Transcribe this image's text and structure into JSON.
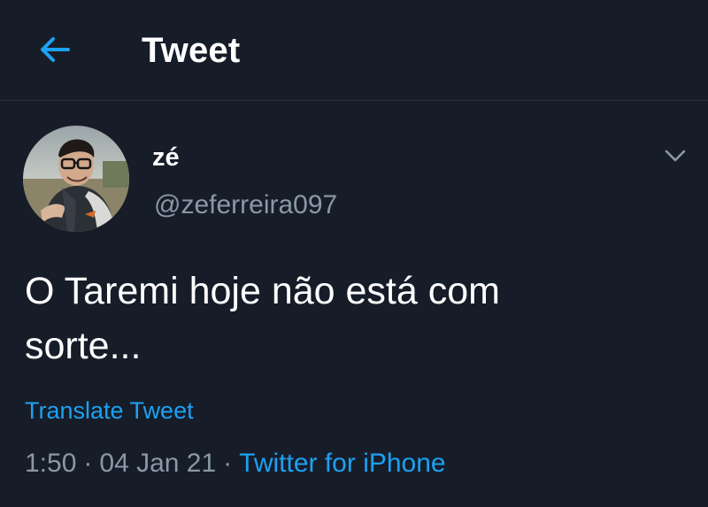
{
  "colors": {
    "background": "#161d29",
    "accent": "#1da1f2",
    "muted_text": "#8b98a6",
    "divider": "#2a3442"
  },
  "header": {
    "title": "Tweet",
    "back_icon": "arrow-left-icon"
  },
  "tweet": {
    "author": {
      "display_name": "zé",
      "handle": "@zeferreira097",
      "avatar": "avatar-photo"
    },
    "menu_icon": "chevron-down-icon",
    "text_line1": "O Taremi hoje não está com",
    "text_line2": "sorte...",
    "translate_label": "Translate Tweet",
    "time": "1:50",
    "separator": "·",
    "date": "04 Jan 21",
    "source": "Twitter for iPhone"
  }
}
